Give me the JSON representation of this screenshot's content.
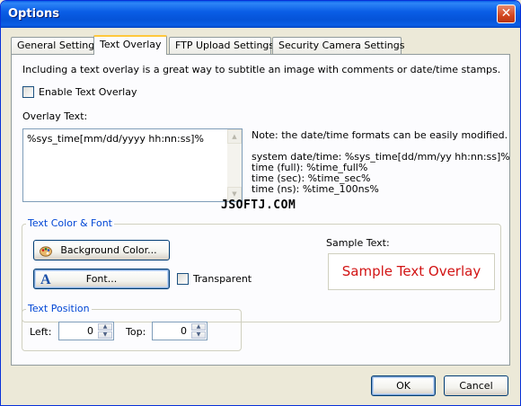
{
  "window": {
    "title": "Options",
    "close_glyph": "✕"
  },
  "tabs": [
    {
      "label": "General Settings"
    },
    {
      "label": "Text Overlay",
      "active": true
    },
    {
      "label": "FTP Upload Settings"
    },
    {
      "label": "Security Camera Settings"
    }
  ],
  "overlay": {
    "intro": "Including a text overlay is a great way to subtitle an image with comments or date/time stamps.",
    "enable_label": "Enable Text Overlay",
    "enable_checked": false,
    "overlay_text_label": "Overlay Text:",
    "overlay_text_value": "%sys_time[mm/dd/yyyy hh:nn:ss]%",
    "note": "Note: the date/time formats can be easily modified.",
    "formats": [
      "system date/time: %sys_time[dd/mm/yy hh:nn:ss]%",
      "time (full): %time_full%",
      "time (sec): %time_sec%",
      "time (ns): %time_100ns%"
    ],
    "watermark": "JSOFTJ.COM"
  },
  "color_font": {
    "group_title": "Text Color & Font",
    "background_color_button": "Background Color...",
    "font_button": "Font...",
    "transparent_label": "Transparent",
    "transparent_checked": false,
    "sample_text_label": "Sample Text:",
    "sample_text": "Sample Text Overlay",
    "sample_color": "#d21414"
  },
  "position": {
    "group_title": "Text Position",
    "left_label": "Left:",
    "left_value": "0",
    "top_label": "Top:",
    "top_value": "0"
  },
  "footer": {
    "ok_label": "OK",
    "cancel_label": "Cancel"
  }
}
